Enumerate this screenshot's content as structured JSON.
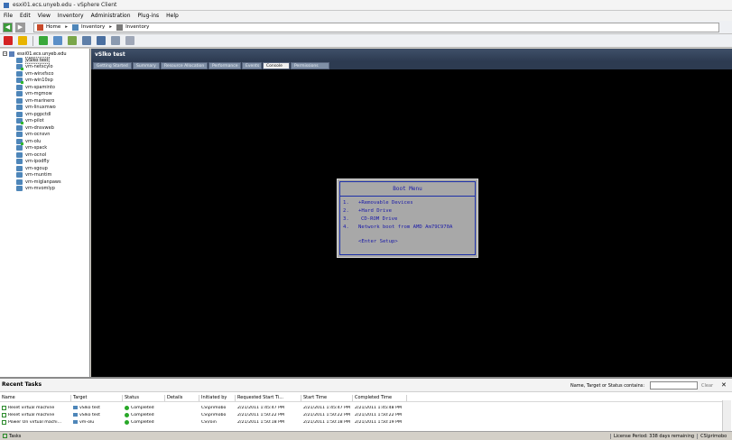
{
  "window": {
    "title": "esxi01.ecs.unyeb.edu - vSphere Client"
  },
  "menu": [
    "File",
    "Edit",
    "View",
    "Inventory",
    "Administration",
    "Plug-ins",
    "Help"
  ],
  "breadcrumb": {
    "home": "Home",
    "inventory": "Inventory",
    "inventory2": "Inventory"
  },
  "tree": {
    "host": "esxi01.ecs.unyeb.edu",
    "items": [
      {
        "label": "vSlko test",
        "on": false,
        "selected": true
      },
      {
        "label": "vm-netscylo",
        "on": true
      },
      {
        "label": "vm-winxfsco",
        "on": false
      },
      {
        "label": "vm-win10xp",
        "on": true
      },
      {
        "label": "vm-spaminto",
        "on": false
      },
      {
        "label": "vm-mgmow",
        "on": false
      },
      {
        "label": "vm-marinero",
        "on": false
      },
      {
        "label": "vm-linuxmwo",
        "on": false
      },
      {
        "label": "vm-pgpctdl",
        "on": false
      },
      {
        "label": "vm-pilot",
        "on": true
      },
      {
        "label": "vm-dnsvweb",
        "on": false
      },
      {
        "label": "vm-ocnsvn",
        "on": false
      },
      {
        "label": "vm-olu",
        "on": true
      },
      {
        "label": "vm-spack",
        "on": false
      },
      {
        "label": "vm-ocnol",
        "on": false
      },
      {
        "label": "vm-ipodfly",
        "on": false
      },
      {
        "label": "vm-sgoup",
        "on": false
      },
      {
        "label": "vm-rnuntim",
        "on": false
      },
      {
        "label": "vm-miglanpaws",
        "on": false
      },
      {
        "label": "vm-mvomlyp",
        "on": false
      }
    ]
  },
  "vm": {
    "title": "vSlko test",
    "tabs": [
      "Getting Started",
      "Summary",
      "Resource Allocation",
      "Performance",
      "Events",
      "Console",
      "Permissions"
    ],
    "active_tab": 5
  },
  "boot_menu": {
    "title": "Boot Menu",
    "options": [
      {
        "num": "1.",
        "text": "+Removable Devices"
      },
      {
        "num": "2.",
        "text": "+Hard Drive"
      },
      {
        "num": "3.",
        "text": "CD-ROM Drive"
      },
      {
        "num": "4.",
        "text": "Network boot from AMD Am79C970A"
      }
    ],
    "setup": "<Enter Setup>"
  },
  "recent_tasks": {
    "title": "Recent Tasks",
    "filter_label": "Name, Target or Status contains:",
    "clear": "Clear",
    "columns": [
      "Name",
      "Target",
      "Status",
      "Details",
      "Initiated by",
      "Requested Start Ti...",
      "Start Time",
      "Completed Time"
    ],
    "rows": [
      {
        "name": "Reset virtual machine",
        "target": "vSlko test",
        "status": "Completed",
        "details": "",
        "initiated": "CS\\primobo",
        "requested": "2/21/2011 1:45:47 PM",
        "start": "2/21/2011 1:45:47 PM",
        "completed": "2/21/2011 1:45:48 PM"
      },
      {
        "name": "Reset virtual machine",
        "target": "vSlko test",
        "status": "Completed",
        "details": "",
        "initiated": "CS\\primobo",
        "requested": "2/21/2011 1:50:22 PM",
        "start": "2/21/2011 1:50:22 PM",
        "completed": "2/21/2011 1:50:22 PM"
      },
      {
        "name": "Power On virtual machi...",
        "target": "vm-olu",
        "status": "Completed",
        "details": "",
        "initiated": "CS\\roin",
        "requested": "2/21/2011 1:50:18 PM",
        "start": "2/21/2011 1:50:18 PM",
        "completed": "2/21/2011 1:50:19 PM"
      }
    ]
  },
  "status_bar": {
    "tasks": "Tasks",
    "license": "License Period: 338 days remaining",
    "user": "CS\\primobo"
  }
}
